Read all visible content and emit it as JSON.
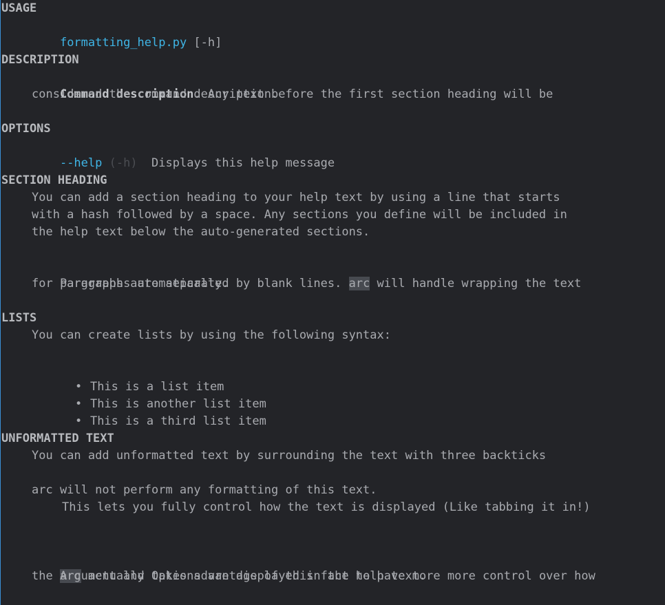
{
  "usage": {
    "heading": "USAGE",
    "command": "formatting_help.py",
    "args": " [-h]"
  },
  "description": {
    "heading": "DESCRIPTION",
    "bold": "Command description",
    "line1_rest": ". Any text before the first section heading will be",
    "line2": "considered the command description."
  },
  "options": {
    "heading": "OPTIONS",
    "flag": "--help",
    "alias": " (-h)",
    "desc": "  Displays this help message"
  },
  "section_heading": {
    "heading": "SECTION HEADING",
    "p1_line1": "You can add a section heading to your help text by using a line that starts",
    "p1_line2": "with a hash followed by a space. Any sections you define will be included in",
    "p1_line3": "the help text below the auto-generated sections.",
    "p2_pre": "Paragraphs are separated by blank lines. ",
    "p2_code": "arc",
    "p2_post": " will handle wrapping the text",
    "p2_line2": "for pargraphs automatically."
  },
  "lists": {
    "heading": "LISTS",
    "intro": "You can create lists by using the following syntax:",
    "bullet": "•",
    "items": [
      "This is a list item",
      "This is another list item",
      "This is a third list item"
    ]
  },
  "unformatted": {
    "heading": "UNFORMATTED TEXT",
    "intro": "You can add unformatted text by surrounding the text with three backticks",
    "code_line1": "arc will not perform any formatting of this text.",
    "code_line2": "This lets you fully control how the text is displayed (Like tabbing it in!)",
    "final_code": "arc",
    "final_rest": " actually takes advantage of this fact to have more more control over how",
    "final_line2": "the Argument and Options are displayed in the help text."
  }
}
